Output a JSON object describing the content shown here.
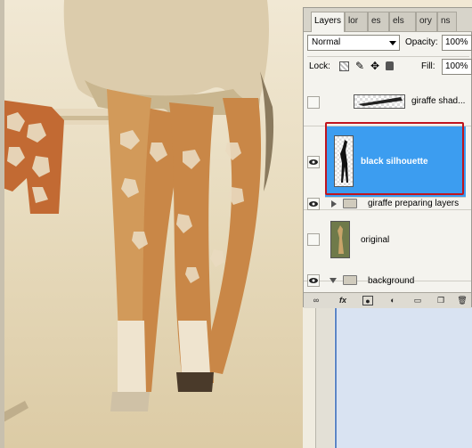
{
  "panel": {
    "tabs": [
      "Layers",
      "lor",
      "es",
      "els",
      "ory",
      "ns"
    ],
    "blend_mode": "Normal",
    "opacity_label": "Opacity:",
    "opacity_value": "100%",
    "lock_label": "Lock:",
    "fill_label": "Fill:",
    "fill_value": "100%"
  },
  "layers": [
    {
      "name": "giraffe shad...",
      "visible": false,
      "type": "layer"
    },
    {
      "name": "black silhouette",
      "visible": true,
      "type": "layer",
      "selected": true
    },
    {
      "name": "giraffe preparing layers",
      "visible": true,
      "type": "group",
      "expanded": false
    },
    {
      "name": "original",
      "visible": false,
      "type": "layer"
    },
    {
      "name": "background",
      "visible": true,
      "type": "group",
      "expanded": true
    }
  ],
  "bottom_icons": [
    "link-icon",
    "fx-icon",
    "mask-icon",
    "adjustment-icon",
    "new-group-icon",
    "new-layer-icon",
    "trash-icon"
  ],
  "colors": {
    "selection": "#3c9df0",
    "highlight_box": "#c0141d",
    "panel_bg": "#f4f3ee"
  }
}
